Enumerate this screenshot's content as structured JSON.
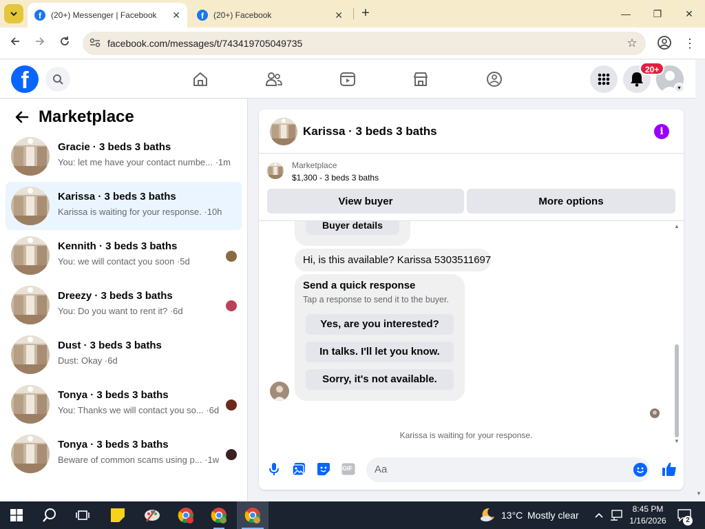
{
  "browser": {
    "tabs": [
      {
        "title": "(20+) Messenger | Facebook",
        "active": true
      },
      {
        "title": "(20+) Facebook",
        "active": false
      }
    ],
    "new_tab_symbol": "+",
    "url": "facebook.com/messages/t/743419705049735",
    "window_controls": {
      "minimize": "—",
      "maximize": "❐",
      "close": "✕"
    }
  },
  "fb_nav": {
    "icons": [
      "facebook-logo",
      "search-icon",
      "home-icon",
      "friends-icon",
      "video-icon",
      "marketplace-icon",
      "groups-icon",
      "menu-grid-icon",
      "notifications-icon",
      "profile-avatar"
    ],
    "notification_badge": "20+",
    "brand_color": "#0866ff"
  },
  "sidebar": {
    "title": "Marketplace",
    "conversations": [
      {
        "name": "Gracie · 3 beds 3 baths",
        "preview": "You: let me have your contact numbe... ·1m",
        "selected": false,
        "seen_color": ""
      },
      {
        "name": "Karissa · 3 beds 3 baths",
        "preview": "Karissa is waiting for your response. ·10h",
        "selected": true,
        "seen_color": ""
      },
      {
        "name": "Kennith · 3 beds 3 baths",
        "preview": "You: we will contact you soon ·5d",
        "selected": false,
        "seen_color": "#8a6a40"
      },
      {
        "name": "Dreezy · 3 beds 3 baths",
        "preview": "You: Do you want to rent it? ·6d",
        "selected": false,
        "seen_color": "#b8445a"
      },
      {
        "name": "Dust · 3 beds 3 baths",
        "preview": "Dust: Okay ·6d",
        "selected": false,
        "seen_color": ""
      },
      {
        "name": "Tonya · 3 beds 3 baths",
        "preview": "You: Thanks we will contact you so... ·6d",
        "selected": false,
        "seen_color": "#6b2a1a"
      },
      {
        "name": "Tonya · 3 beds 3 baths",
        "preview": "Beware of common scams using p... ·1w",
        "selected": false,
        "seen_color": "#3a2020"
      }
    ]
  },
  "chat": {
    "header_name": "Karissa · 3 beds 3 baths",
    "info_color": "#9a00ff",
    "listing": {
      "source": "Marketplace",
      "price_title": "$1,300 - 3 beds 3 baths",
      "view_buyer": "View buyer",
      "more_options": "More options"
    },
    "buyer_details_button": "Buyer details",
    "message": "Hi, is this available? Karissa 5303511697",
    "quick_response": {
      "title": "Send a quick response",
      "subtitle": "Tap a response to send it to the buyer.",
      "options": [
        "Yes, are you interested?",
        "In talks. I'll let you know.",
        "Sorry, it's not available."
      ]
    },
    "waiting_text": "Karissa is waiting for your response.",
    "composer": {
      "placeholder": "Aa",
      "icons": [
        "microphone-icon",
        "photo-icon",
        "sticker-icon",
        "gif-icon",
        "emoji-icon",
        "thumbs-up-icon"
      ],
      "gif_label": "GIF"
    }
  },
  "taskbar": {
    "weather_temp": "13°C",
    "weather_desc": "Mostly clear",
    "time": "8:45 PM",
    "date": "1/16/2026",
    "notification_count": "2"
  }
}
